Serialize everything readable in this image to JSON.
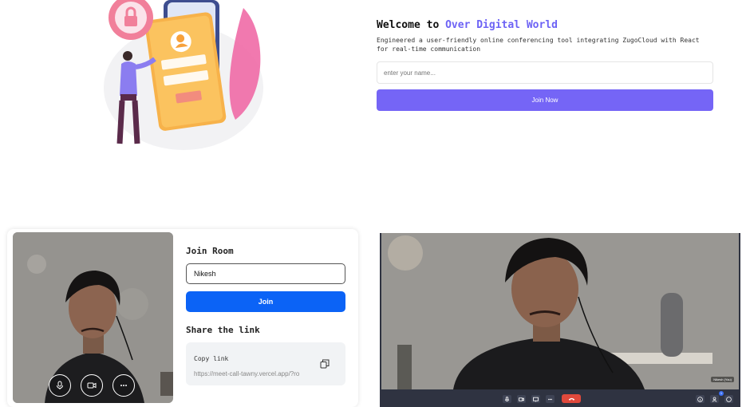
{
  "welcome": {
    "title_prefix": "Welcome to ",
    "title_accent": "Over Digital World",
    "description": "Engineered a user-friendly online conferencing tool integrating ZugoCloud with React for real-time communication",
    "name_placeholder": "enter your name...",
    "join_label": "Join Now"
  },
  "lobby": {
    "join_room_title": "Join Room",
    "room_name_value": "Nikesh",
    "join_label": "Join",
    "share_title": "Share the link",
    "copy_label": "Copy link",
    "copy_url": "https://meet-call-tawny.vercel.app/?ro"
  },
  "meeting": {
    "participant_tag": "Nikesh (You)",
    "participant_count": "1"
  },
  "colors": {
    "accent_purple": "#7565f6",
    "join_blue": "#0b63f6",
    "end_call_red": "#e0493c"
  },
  "icons": [
    "lock-icon",
    "user-icon",
    "mic-icon",
    "camera-icon",
    "more-icon",
    "copy-icon",
    "screen-share-icon",
    "end-call-icon",
    "info-icon",
    "participants-icon",
    "chat-icon"
  ]
}
